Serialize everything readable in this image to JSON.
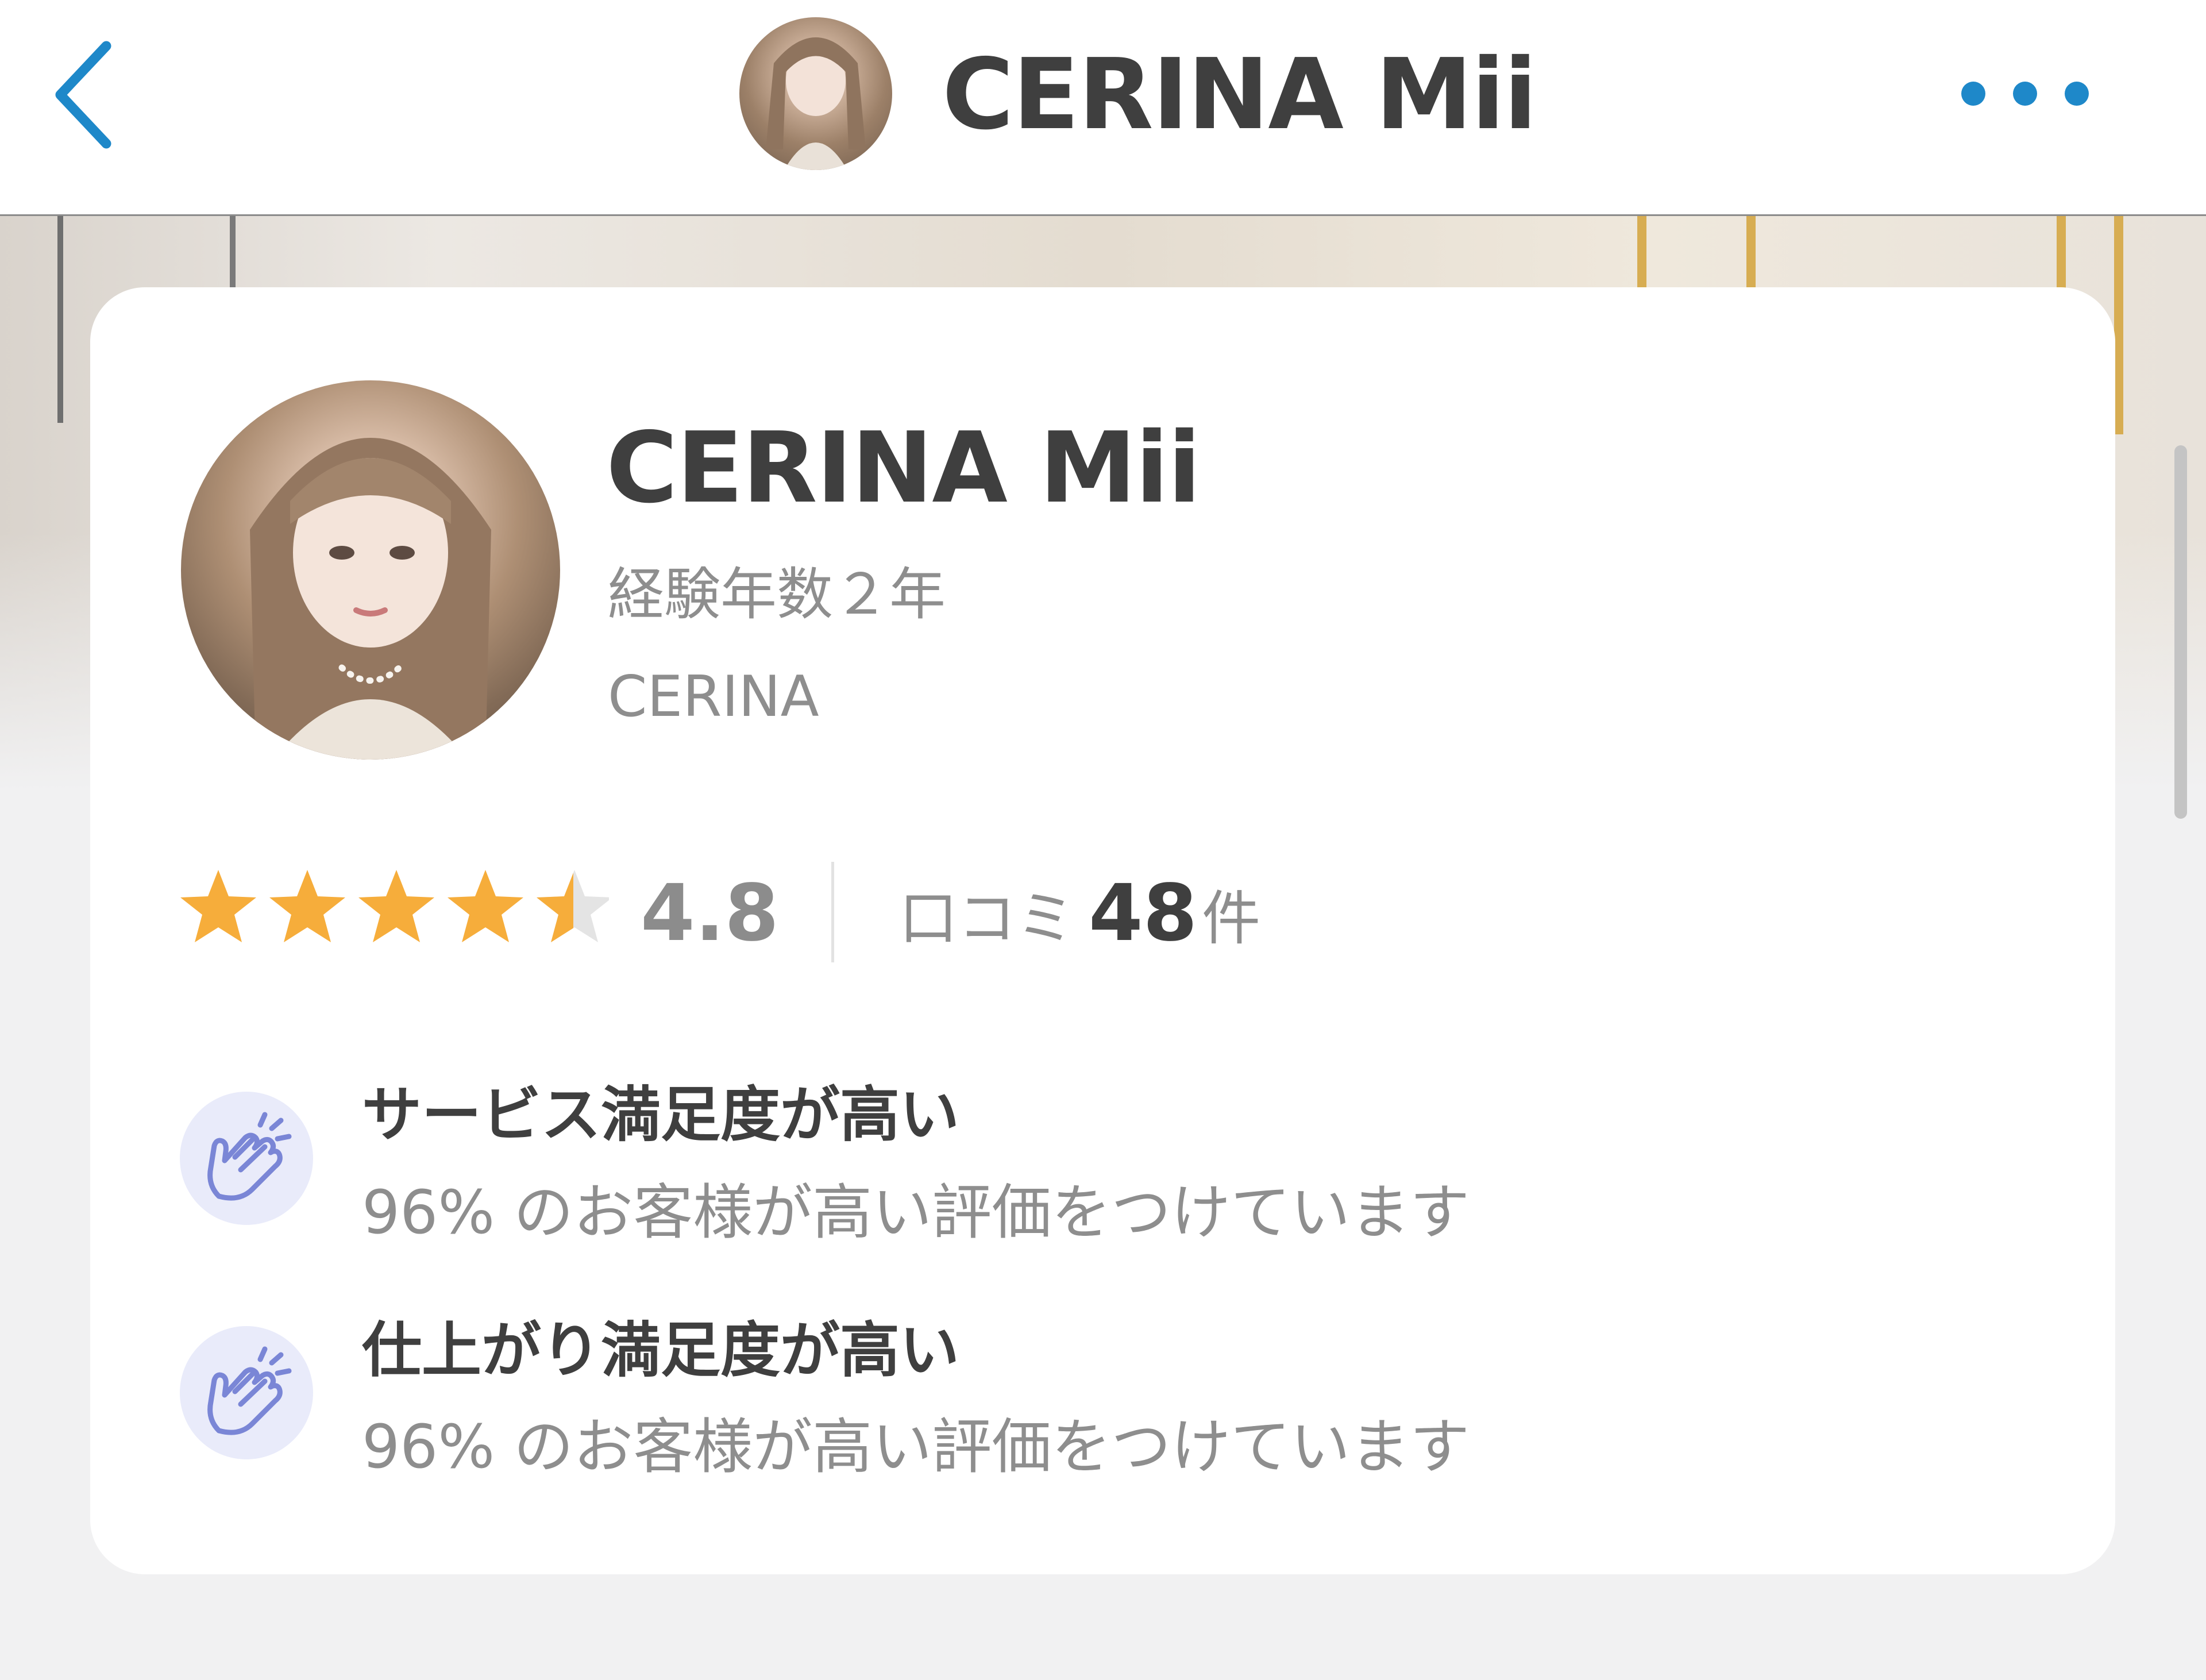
{
  "header": {
    "title": "CERINA Mii",
    "back_icon": "chevron-left-icon",
    "more_icon": "more-horizontal-icon",
    "accent_color": "#1e88c9"
  },
  "profile": {
    "name": "CERINA Mii",
    "experience": "経験年数２年",
    "salon": "CERINA",
    "rating": {
      "value": "4.8",
      "max_stars": 5,
      "star_color": "#f6ad3b"
    },
    "reviews": {
      "label": "口コミ",
      "count": "48",
      "unit": "件"
    }
  },
  "features": [
    {
      "icon": "clapping-hands-icon",
      "title": "サービス満足度が高い",
      "description": "96% のお客様が高い評価をつけています"
    },
    {
      "icon": "clapping-hands-icon",
      "title": "仕上がり満足度が高い",
      "description": "96% のお客様が高い評価をつけています"
    }
  ],
  "colors": {
    "icon_circle_bg": "#e9ebfa",
    "icon_stroke": "#7a86d6"
  }
}
